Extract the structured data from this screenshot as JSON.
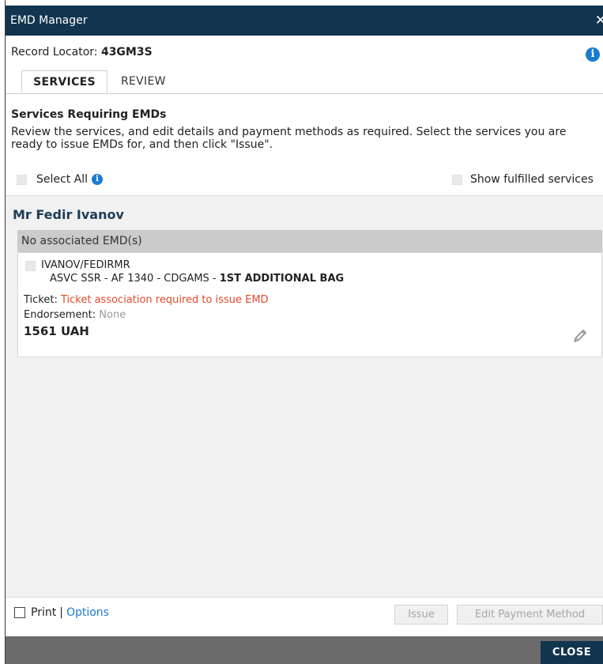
{
  "window": {
    "title": "EMD Manager",
    "close_glyph": "✕"
  },
  "record": {
    "label": "Record Locator: ",
    "value": "43GM3S"
  },
  "info_icon": "info-icon",
  "tabs": [
    {
      "label": "SERVICES",
      "active": true
    },
    {
      "label": "REVIEW",
      "active": false
    }
  ],
  "section": {
    "heading": "Services Requiring EMDs",
    "description": "Review the services, and edit details and payment methods as required. Select the services you are ready to issue EMDs for, and then click \"Issue\"."
  },
  "filters": {
    "select_all": "Select All",
    "show_fulfilled": "Show fulfilled services"
  },
  "passenger": {
    "name": "Mr Fedir Ivanov",
    "emd_status": "No associated EMD(s)",
    "service": {
      "pax_code": "IVANOV/FEDIRMR",
      "detail": "ASVC  SSR  - AF 1340 -  CDGAMS  - ",
      "description": "1ST ADDITIONAL BAG",
      "ticket_label": "Ticket: ",
      "ticket_value": "Ticket association required to issue EMD",
      "endorsement_label": "Endorsement: ",
      "endorsement_value": "None",
      "amount": "1561 UAH"
    }
  },
  "bottom": {
    "print_label": "Print",
    "separator": "|",
    "options_label": "Options",
    "issue_label": "Issue",
    "edit_payment_label": "Edit Payment Method"
  },
  "footer": {
    "close_label": "CLOSE"
  },
  "colors": {
    "titlebar": "#11344f",
    "accent": "#1a7bd1",
    "error": "#e04a2a",
    "passenger_name": "#1d3c56"
  }
}
